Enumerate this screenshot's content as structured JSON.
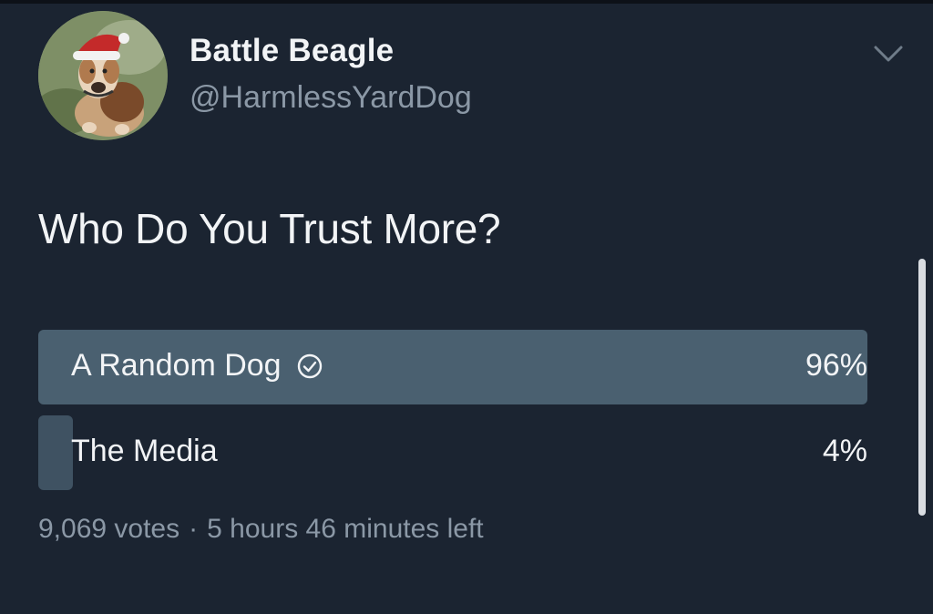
{
  "tweet": {
    "display_name": "Battle Beagle",
    "handle": "@HarmlessYardDog",
    "question": "Who Do You Trust More?",
    "options": [
      {
        "label": "A Random Dog",
        "percent_text": "96%",
        "percent": 96,
        "winner": true
      },
      {
        "label": "The Media",
        "percent_text": "4%",
        "percent": 4,
        "winner": false
      }
    ],
    "votes": "9,069 votes",
    "separator": "·",
    "time_left": "5 hours 46 minutes left"
  },
  "icons": {
    "menu": "chevron-down-icon",
    "winner": "check-circle-icon"
  },
  "colors": {
    "background": "#1b2431",
    "poll_fill": "#4a6070",
    "secondary_text": "#8b98a6"
  }
}
